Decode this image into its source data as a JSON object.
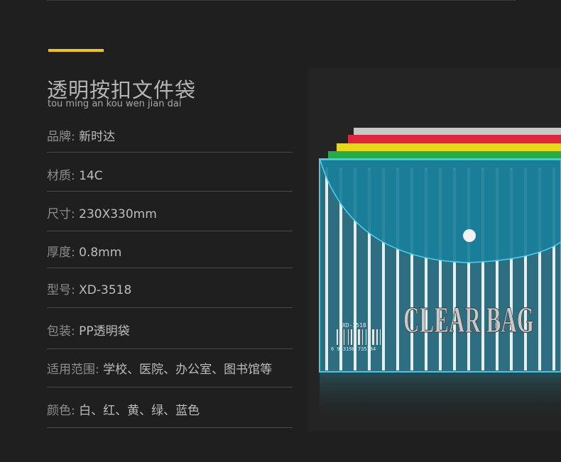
{
  "header": {
    "title_cn": "透明按扣文件袋",
    "title_pinyin": "tou ming an kou wen jian dai",
    "accent_color": "#f0c419"
  },
  "specs": [
    {
      "label": "品牌",
      "value": "新时达"
    },
    {
      "label": "材质",
      "value": "14C"
    },
    {
      "label": "尺寸",
      "value": "230X330mm"
    },
    {
      "label": "厚度",
      "value": "0.8mm"
    },
    {
      "label": "型号",
      "value": "XD-3518"
    },
    {
      "label": "包装",
      "value": "PP透明袋"
    },
    {
      "label": "适用范围",
      "value": "学校、医院、办公室、图书馆等"
    },
    {
      "label": "颜色",
      "value": "白、红、黄、绿、蓝色"
    }
  ],
  "spec_separator": ":",
  "product": {
    "bag_text": "CLEAR BAG",
    "model_label": "XD-3518",
    "barcode_number": "6 943198 735184",
    "bag_colors": [
      "#c8c8c8",
      "#e0263a",
      "#e8d81c",
      "#1fae4a",
      "#1a9ab8"
    ]
  }
}
